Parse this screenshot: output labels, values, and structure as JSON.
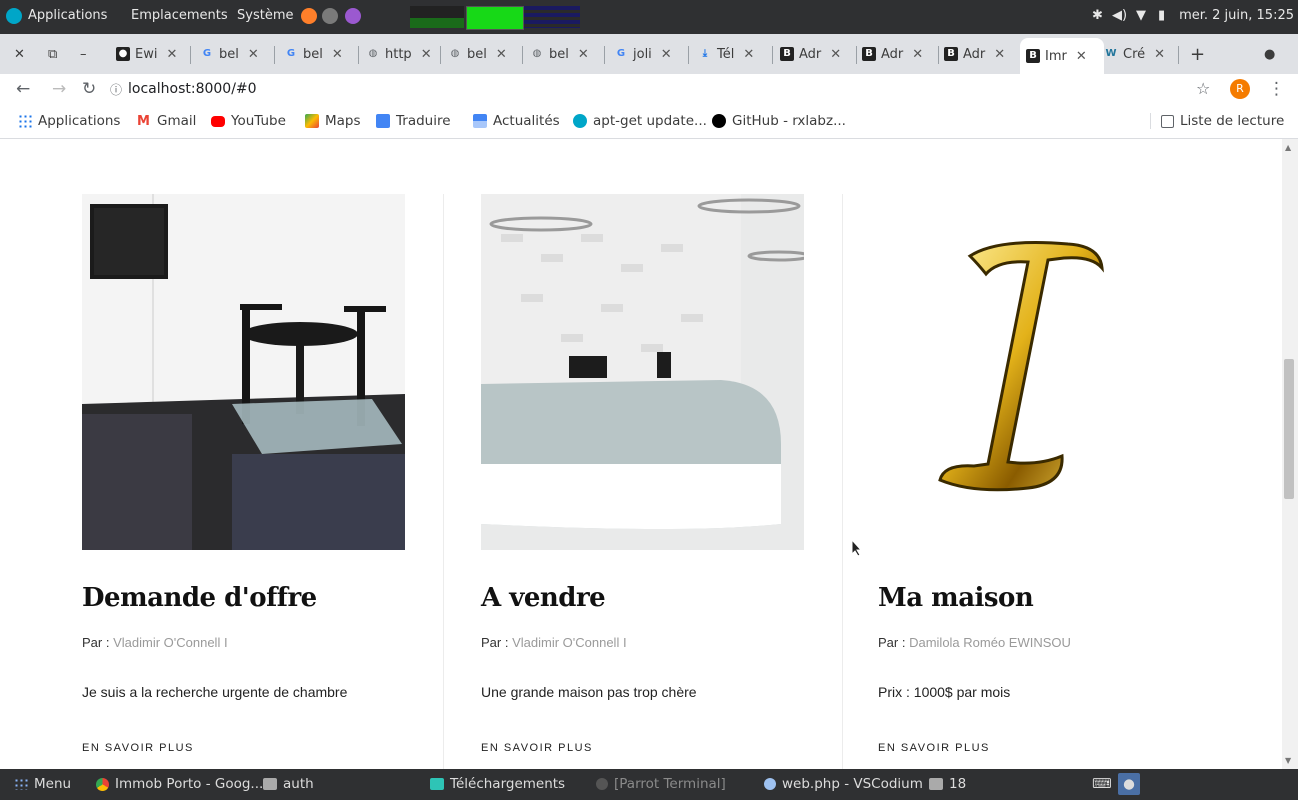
{
  "system_panel": {
    "menu_apps": "Applications",
    "menu_places": "Emplacements",
    "menu_system": "Système",
    "clock": "mer. 2 juin, 15:25"
  },
  "tabs": [
    {
      "label": "Ewi",
      "icon": "github-icon"
    },
    {
      "label": "bel",
      "icon": "google-icon"
    },
    {
      "label": "bel",
      "icon": "google-icon"
    },
    {
      "label": "http",
      "icon": "globe-icon"
    },
    {
      "label": "bel",
      "icon": "globe-icon"
    },
    {
      "label": "bel",
      "icon": "globe-icon"
    },
    {
      "label": "joli",
      "icon": "google-icon"
    },
    {
      "label": "Tél",
      "icon": "download-icon"
    },
    {
      "label": "Adr",
      "icon": "bootstrap-icon"
    },
    {
      "label": "Adr",
      "icon": "bootstrap-icon"
    },
    {
      "label": "Adr",
      "icon": "bootstrap-icon"
    },
    {
      "label": "Imr",
      "icon": "bootstrap-icon"
    },
    {
      "label": "Cré",
      "icon": "wordpress-icon"
    }
  ],
  "address_bar": {
    "url": "localhost:8000/#0",
    "avatar_letter": "R"
  },
  "bookmarks": [
    {
      "label": "Applications",
      "icon": "apps-grid-icon",
      "color": "#1a73e8"
    },
    {
      "label": "Gmail",
      "icon": "gmail-icon",
      "color": "#ea4335"
    },
    {
      "label": "YouTube",
      "icon": "youtube-icon",
      "color": "#ff0000"
    },
    {
      "label": "Maps",
      "icon": "maps-icon",
      "color": "#34a853"
    },
    {
      "label": "Traduire",
      "icon": "translate-icon",
      "color": "#4285f4"
    },
    {
      "label": "Actualités",
      "icon": "news-icon",
      "color": "#4285f4"
    },
    {
      "label": "apt-get update...",
      "icon": "parrot-icon",
      "color": "#00a6c8"
    },
    {
      "label": "GitHub - rxlabz...",
      "icon": "github-icon",
      "color": "#000000"
    }
  ],
  "reading_list": "Liste de lecture",
  "cards": [
    {
      "title": "Demande d'offre",
      "by_label": "Par :",
      "author": "Vladimir O'Connell I",
      "description": "Je suis a la recherche urgente de chambre",
      "more": "EN SAVOIR PLUS",
      "image": "room-table-chairs"
    },
    {
      "title": "A vendre",
      "by_label": "Par :",
      "author": "Vladimir O'Connell I",
      "description": "Une grande maison pas trop chère",
      "more": "EN SAVOIR PLUS",
      "image": "reception-desk"
    },
    {
      "title": "Ma maison",
      "by_label": "Par :",
      "author": "Damilola Roméo EWINSOU",
      "description": "Prix : 1000$ par mois",
      "more": "EN SAVOIR PLUS",
      "image": "gold-letter-i"
    }
  ],
  "taskbar": {
    "menu": "Menu",
    "items": [
      {
        "label": "Immob Porto - Goog...",
        "icon": "chrome-icon"
      },
      {
        "label": "auth",
        "icon": "folder-icon"
      },
      {
        "label": "Téléchargements",
        "icon": "folder-icon"
      },
      {
        "label": "[Parrot Terminal]",
        "icon": "terminal-icon"
      },
      {
        "label": "web.php - VSCodium",
        "icon": "vscodium-icon"
      },
      {
        "label": "18",
        "icon": "folder-icon"
      }
    ]
  }
}
